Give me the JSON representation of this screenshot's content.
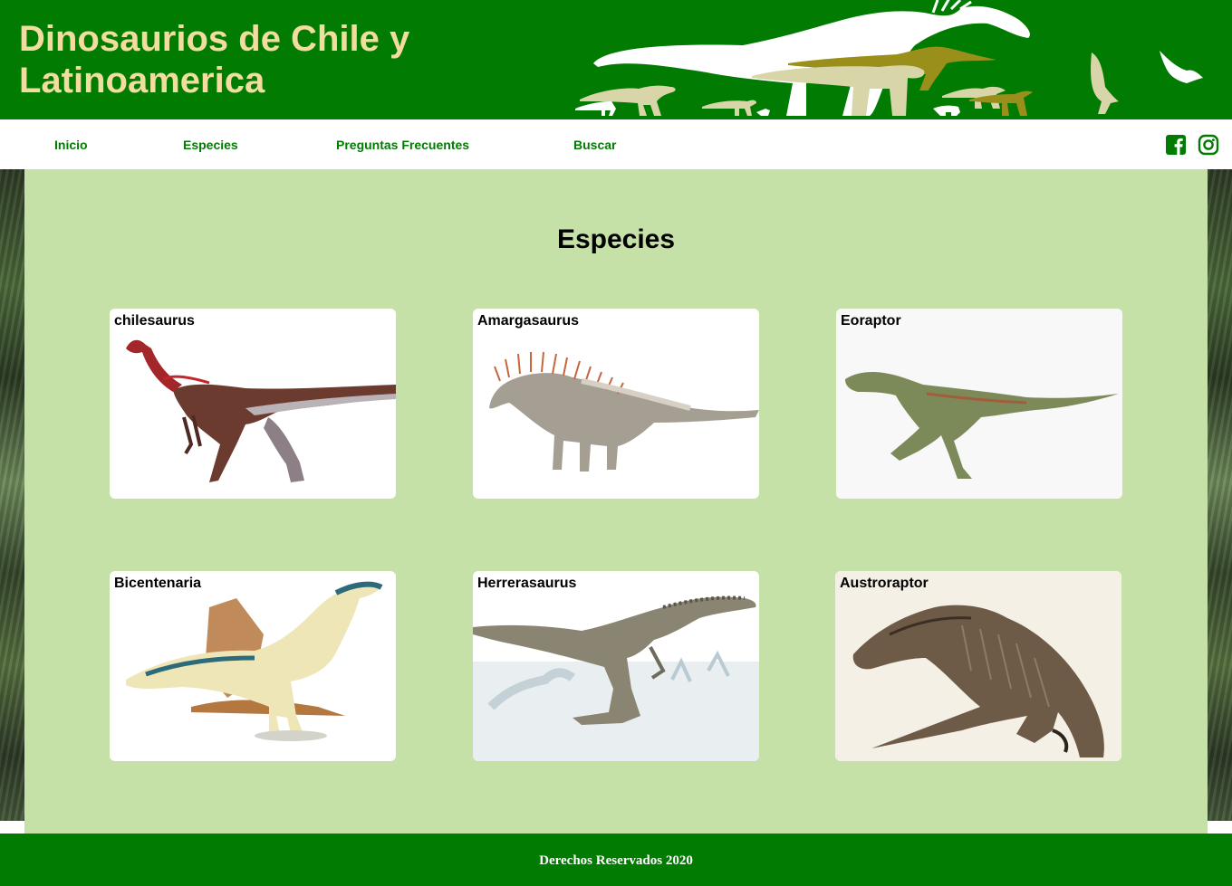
{
  "header": {
    "title": "Dinosaurios de Chile y Latinoamerica",
    "brand_color": "#017b01",
    "title_color": "#f3dca0"
  },
  "nav": {
    "items": [
      {
        "label": "Inicio"
      },
      {
        "label": "Especies"
      },
      {
        "label": "Preguntas Frecuentes"
      },
      {
        "label": "Buscar"
      }
    ],
    "social": [
      {
        "icon": "facebook-icon"
      },
      {
        "icon": "instagram-icon"
      }
    ]
  },
  "main": {
    "heading": "Especies",
    "background": "#c6e1a8",
    "species": [
      {
        "name": "chilesaurus"
      },
      {
        "name": "Amargasaurus"
      },
      {
        "name": "Eoraptor"
      },
      {
        "name": "Bicentenaria"
      },
      {
        "name": "Herrerasaurus"
      },
      {
        "name": "Austroraptor"
      }
    ]
  },
  "footer": {
    "text": "Derechos Reservados 2020"
  }
}
